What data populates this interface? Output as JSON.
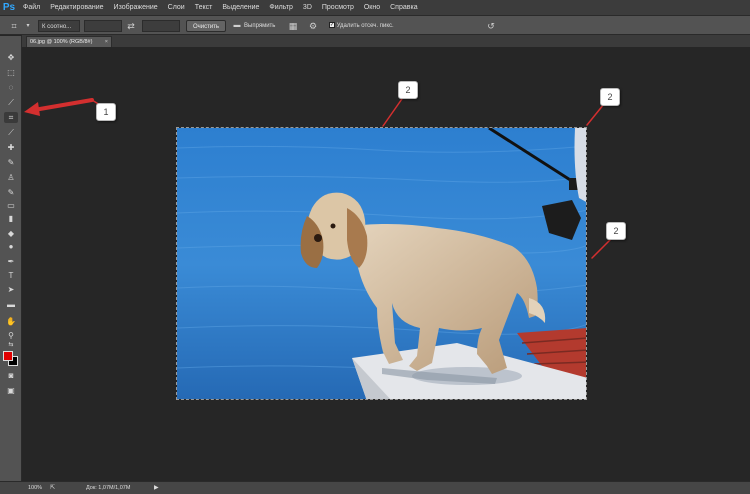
{
  "app": {
    "logo": "Ps"
  },
  "menu": [
    "Файл",
    "Редактирование",
    "Изображение",
    "Слои",
    "Текст",
    "Выделение",
    "Фильтр",
    "3D",
    "Просмотр",
    "Окно",
    "Справка"
  ],
  "options": {
    "ratio_value": "К соотно...",
    "clear_button": "Очистить",
    "straighten_label": "Выпрямить",
    "delete_pixels_label": "Удалить отсеч. пикс."
  },
  "document": {
    "tab_label": "06.jpg @ 100% (RGB/8#)"
  },
  "status": {
    "zoom": "100%",
    "doc_size": "Док: 1,07М/1,07М"
  },
  "annotations": [
    "1",
    "2",
    "2",
    "2"
  ],
  "colors": {
    "accent": "#d32f2f",
    "foreground": "#e00000",
    "background": "#000000",
    "logo": "#31a8ff"
  },
  "icons": [
    "crop-icon",
    "swap-icon",
    "straighten-icon",
    "grid-overlay-icon",
    "gear-icon",
    "reset-icon"
  ]
}
